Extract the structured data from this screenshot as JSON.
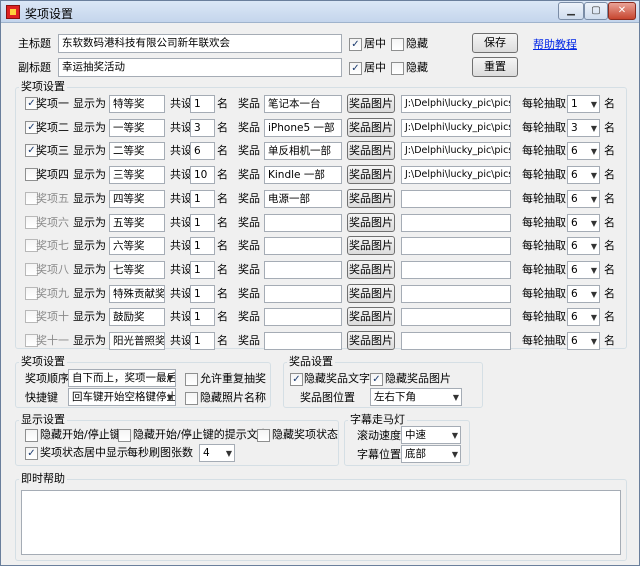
{
  "window": {
    "title": "奖项设置"
  },
  "header": {
    "main_label": "主标题",
    "main_value": "东软数码港科技有限公司新年联欢会",
    "sub_label": "副标题",
    "sub_value": "幸运抽奖活动",
    "center_label": "居中",
    "hide_label": "隐藏",
    "save_label": "保存",
    "reset_label": "重置",
    "help_link": "帮助教程"
  },
  "prizes": {
    "group_label": "奖项设置",
    "show_as": "显示为",
    "total": "共设",
    "unit": "名",
    "item_label": "奖品",
    "image_btn": "奖品图片",
    "per_round": "每轮抽取",
    "rows": [
      {
        "name": "奖项一",
        "checked": true,
        "display": "特等奖",
        "count": "1",
        "item": "笔记本一台",
        "path": "J:\\Delphi\\lucky_pic\\pics\\0.jpg",
        "per": "1"
      },
      {
        "name": "奖项二",
        "checked": true,
        "display": "一等奖",
        "count": "3",
        "item": "iPhone5 一部",
        "path": "J:\\Delphi\\lucky_pic\\pics\\1.jpg",
        "per": "3"
      },
      {
        "name": "奖项三",
        "checked": true,
        "display": "二等奖",
        "count": "6",
        "item": "单反相机一部",
        "path": "J:\\Delphi\\lucky_pic\\pics\\2.jpg",
        "per": "6"
      },
      {
        "name": "奖项四",
        "checked": false,
        "display": "三等奖",
        "count": "10",
        "item": "Kindle 一部",
        "path": "J:\\Delphi\\lucky_pic\\pics\\3.jpg",
        "per": "6"
      },
      {
        "name": "奖项五",
        "checked": false,
        "display": "四等奖",
        "count": "1",
        "item": "电源一部",
        "path": "",
        "per": "6"
      },
      {
        "name": "奖项六",
        "checked": false,
        "display": "五等奖",
        "count": "1",
        "item": "",
        "path": "",
        "per": "6"
      },
      {
        "name": "奖项七",
        "checked": false,
        "display": "六等奖",
        "count": "1",
        "item": "",
        "path": "",
        "per": "6"
      },
      {
        "name": "奖项八",
        "checked": false,
        "display": "七等奖",
        "count": "1",
        "item": "",
        "path": "",
        "per": "6"
      },
      {
        "name": "奖项九",
        "checked": false,
        "display": "特殊贡献奖",
        "count": "1",
        "item": "",
        "path": "",
        "per": "6"
      },
      {
        "name": "奖项十",
        "checked": false,
        "display": "鼓励奖",
        "count": "1",
        "item": "",
        "path": "",
        "per": "6"
      },
      {
        "name": "奖十一",
        "checked": false,
        "display": "阳光普照奖",
        "count": "1",
        "item": "",
        "path": "",
        "per": "6"
      }
    ]
  },
  "prize_settings": {
    "group_label": "奖项设置",
    "order_label": "奖项顺序",
    "order_value": "自下而上，奖项一最后",
    "allow_repeat": "允许重复抽奖",
    "shortcut_label": "快捷键",
    "shortcut_value": "回车键开始空格键停止",
    "hide_photo_name": "隐藏照片名称"
  },
  "item_settings": {
    "group_label": "奖品设置",
    "hide_text": "隐藏奖品文字",
    "hide_image": "隐藏奖品图片",
    "pos_label": "奖品图位置",
    "pos_value": "左右下角"
  },
  "display_settings": {
    "group_label": "显示设置",
    "hide_start_stop": "隐藏开始/停止键",
    "hide_hint": "隐藏开始/停止键的提示文字",
    "hide_status": "隐藏奖项状态",
    "center_status": "奖项状态居中显示",
    "refresh_label": "每秒刷图张数",
    "refresh_value": "4"
  },
  "marquee": {
    "group_label": "字幕走马灯",
    "speed_label": "滚动速度",
    "speed_value": "中速",
    "pos_label": "字幕位置",
    "pos_value": "底部"
  },
  "help": {
    "group_label": "即时帮助"
  }
}
